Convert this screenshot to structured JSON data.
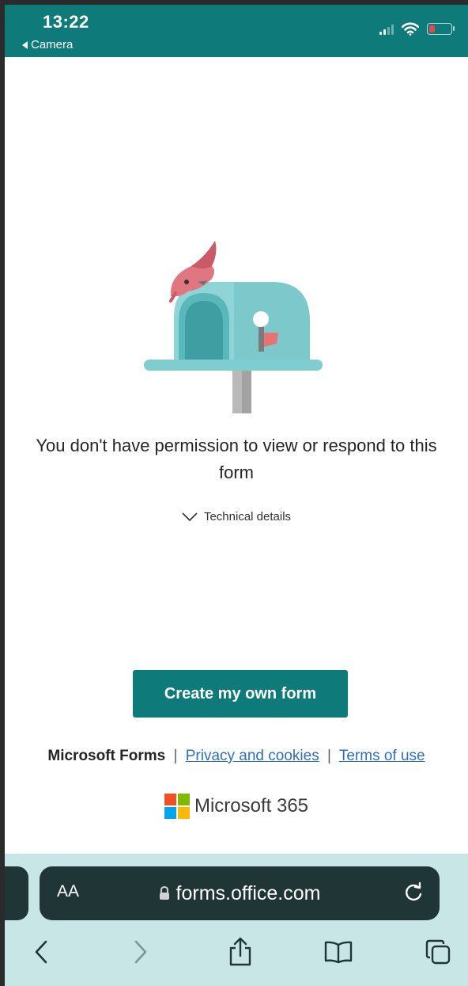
{
  "status_bar": {
    "time": "13:22",
    "back_label": "Camera"
  },
  "content": {
    "message": "You don't have permission to view or respond to this form",
    "technical_details": "Technical details",
    "create_button": "Create my own form"
  },
  "footer": {
    "brand": "Microsoft Forms",
    "separator": "|",
    "privacy_link": "Privacy and cookies",
    "terms_link": "Terms of use",
    "ms365_label": "Microsoft 365"
  },
  "browser": {
    "text_size_label": "AA",
    "url": "forms.office.com"
  },
  "colors": {
    "brand_teal": "#0f7a7a",
    "link_blue": "#2c6ec4",
    "browser_bg": "#c8e6e6",
    "url_bar_bg": "#1f3536"
  },
  "icons": [
    "signal-icon",
    "wifi-icon",
    "battery-icon",
    "mailbox-illustration",
    "chevron-down-icon",
    "microsoft-logo-icon",
    "lock-icon",
    "reload-icon",
    "back-icon",
    "forward-icon",
    "share-icon",
    "bookmarks-icon",
    "tabs-icon"
  ]
}
